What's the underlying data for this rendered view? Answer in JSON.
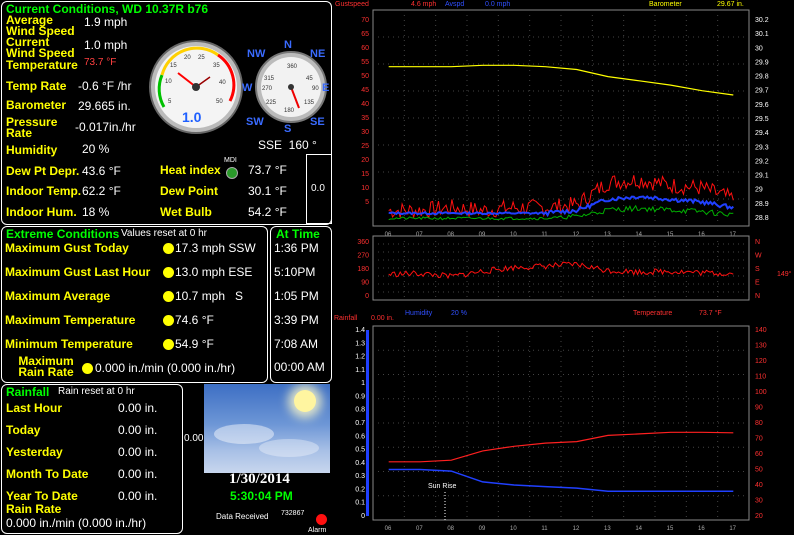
{
  "current": {
    "title": "Current Conditions, WD 10.37R b76",
    "avg_wind_label": "Average Wind Speed",
    "avg_wind_value": "1.9 mph",
    "cur_wind_label": "Current Wind Speed",
    "cur_wind_value": "1.0 mph",
    "temp_label": "Temperature",
    "temp_value": "73.7 °F",
    "temp_rate_label": "Temp Rate",
    "temp_rate_value": "-0.6 °F /hr",
    "baro_label": "Barometer",
    "baro_value": "29.665 in.",
    "press_rate_label": "Pressure Rate",
    "press_rate_value": "-0.017in./hr",
    "humidity_label": "Humidity",
    "humidity_value": "20 %",
    "dewdepr_label": "Dew Pt Depr.",
    "dewdepr_value": "43.6 °F",
    "indoor_temp_label": "Indoor Temp.",
    "indoor_temp_value": "62.2 °F",
    "indoor_hum_label": "Indoor Hum.",
    "indoor_hum_value": "18 %",
    "heat_label": "Heat index",
    "heat_value": "73.7 °F",
    "dew_label": "Dew Point",
    "dew_value": "30.1 °F",
    "wet_label": "Wet Bulb",
    "wet_value": "54.2 °F",
    "mdi": "MDI",
    "gauge_value": "1.0",
    "dir_text": "SSE  160 °",
    "side_value": "0.0"
  },
  "extreme": {
    "title": "Extreme Conditions",
    "subtitle": "Values reset at 0 hr",
    "at_time_title": "At Time",
    "rows": [
      {
        "label": "Maximum Gust Today",
        "value": "17.3 mph SSW",
        "time": "1:36 PM"
      },
      {
        "label": "Maximum Gust Last Hour",
        "value": "13.0 mph ESE",
        "time": "5:10PM"
      },
      {
        "label": "Maximum Average",
        "value": "10.7 mph   S",
        "time": "1:05 PM"
      },
      {
        "label": "Maximum Temperature",
        "value": "74.6 °F",
        "time": "3:39 PM"
      },
      {
        "label": "Minimum Temperature",
        "value": "54.9 °F",
        "time": "7:08 AM"
      }
    ],
    "rain_rate_label": "Maximum Rain Rate",
    "rain_rate_value": "0.000 in./min (0.000 in./hr)",
    "rain_rate_time": "00:00 AM"
  },
  "rainfall": {
    "title": "Rainfall",
    "subtitle": "Rain reset at 0 hr",
    "rows": [
      {
        "label": "Last Hour",
        "value": "0.00 in."
      },
      {
        "label": "Today",
        "value": "0.00 in."
      },
      {
        "label": "Yesterday",
        "value": "0.00 in."
      },
      {
        "label": "Month To Date",
        "value": "0.00 in."
      },
      {
        "label": "Year To Date",
        "value": "0.00 in."
      }
    ],
    "rate_label": "Rain Rate",
    "rate_value": "0.000 in./min (0.000 in./hr)",
    "side_value": "0.00"
  },
  "status": {
    "date": "1/30/2014",
    "time": "5:30:04 PM",
    "data_received_label": "Data Received",
    "data_received_value": "732867",
    "alarm_label": "Alarm"
  },
  "graphs": {
    "top_header": {
      "gust_label": "Gustspeed",
      "gust_value": "4.6 mph",
      "avg_label": "Avspd",
      "avg_value": "0.0 mph",
      "baro_label": "Barometer",
      "baro_value": "29.67 in."
    },
    "mid_header": {
      "humidity_label": "Humidity",
      "humidity_value": "20 %",
      "temp_label": "Temperature",
      "temp_value": "73.7 °F"
    },
    "bot_header": {
      "rain_label": "Rainfall",
      "rain_value": "0.00 in."
    },
    "sunrise_label": "Sun Rise",
    "dir_now": "149°"
  },
  "chart_data": [
    {
      "type": "line",
      "title": "",
      "x": [
        "06",
        "07",
        "08",
        "09",
        "10",
        "11",
        "12",
        "13",
        "14",
        "15",
        "16",
        "17"
      ],
      "series": [
        {
          "name": "Gustspeed",
          "unit": "mph",
          "values": [
            2,
            2,
            3,
            2,
            3,
            3,
            4,
            12,
            13,
            11,
            10,
            6
          ]
        },
        {
          "name": "Avspd",
          "unit": "mph",
          "values": [
            1,
            1,
            1,
            1,
            1,
            1,
            2,
            6,
            7,
            6,
            5,
            3
          ]
        },
        {
          "name": "Barometer",
          "unit": "in.",
          "values": [
            29.87,
            29.87,
            29.87,
            29.88,
            29.88,
            29.87,
            29.85,
            29.8,
            29.77,
            29.74,
            29.7,
            29.67
          ]
        }
      ],
      "left_ticks": [
        5,
        10,
        15,
        20,
        25,
        30,
        35,
        40,
        45,
        50,
        55,
        60,
        65,
        70
      ],
      "right_ticks": [
        28.8,
        28.9,
        29,
        29.1,
        29.2,
        29.3,
        29.4,
        29.5,
        29.6,
        29.7,
        29.8,
        29.9,
        30,
        30.1,
        30.2
      ]
    },
    {
      "type": "line",
      "title": "",
      "x": [
        "06",
        "07",
        "08",
        "09",
        "10",
        "11",
        "12",
        "13",
        "14",
        "15",
        "16",
        "17"
      ],
      "series": [
        {
          "name": "Wind Direction",
          "unit": "deg",
          "values": [
            145,
            150,
            130,
            165,
            190,
            200,
            210,
            170,
            160,
            165,
            155,
            150
          ]
        }
      ],
      "left_ticks": [
        0,
        90,
        180,
        270,
        360
      ],
      "right_ticks": [
        "N",
        "E",
        "S",
        "W",
        "N"
      ]
    },
    {
      "type": "line",
      "title": "",
      "x": [
        "06",
        "07",
        "08",
        "09",
        "10",
        "11",
        "12",
        "13",
        "14",
        "15",
        "16",
        "17"
      ],
      "series": [
        {
          "name": "Humidity",
          "unit": "%",
          "values": [
            34,
            34,
            33,
            26,
            24,
            23,
            22,
            20,
            20,
            20,
            20,
            20
          ]
        },
        {
          "name": "Temperature",
          "unit": "°F",
          "values": [
            55,
            55,
            56,
            62,
            65,
            67,
            68,
            72,
            73,
            74,
            74,
            73.7
          ]
        }
      ],
      "left_ticks": [
        0,
        0.1,
        0.2,
        0.3,
        0.4,
        0.5,
        0.6,
        0.7,
        0.8,
        0.9,
        1,
        1.1,
        1.2,
        1.3,
        1.4
      ],
      "right_ticks": [
        20,
        30,
        40,
        50,
        60,
        70,
        80,
        90,
        100,
        110,
        120,
        130,
        140
      ]
    }
  ]
}
